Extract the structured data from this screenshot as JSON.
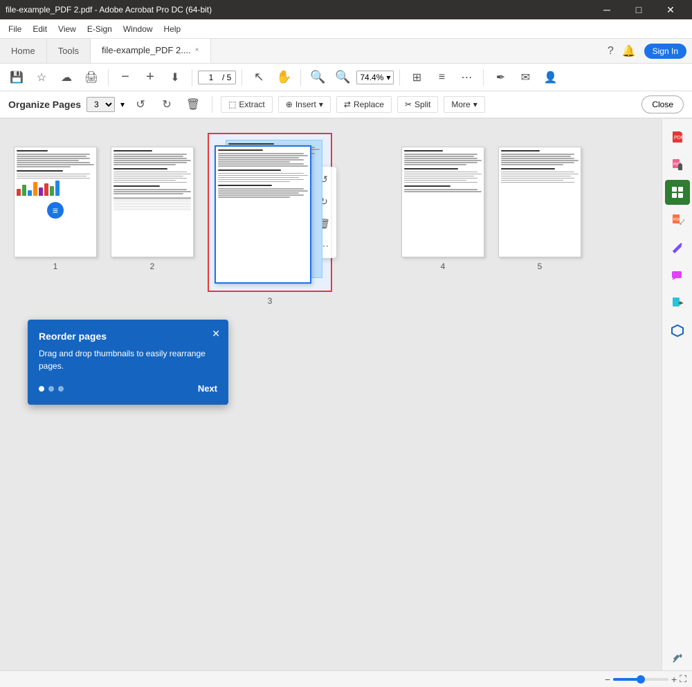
{
  "titlebar": {
    "title": "file-example_PDF 2.pdf - Adobe Acrobat Pro DC (64-bit)",
    "minimize": "─",
    "maximize": "□",
    "close": "✕"
  },
  "menubar": {
    "items": [
      "File",
      "Edit",
      "View",
      "E-Sign",
      "Window",
      "Help"
    ]
  },
  "tabs": {
    "home": "Home",
    "tools": "Tools",
    "file": "file-example_PDF 2....",
    "close_label": "×"
  },
  "tabbar_right": {
    "help": "?",
    "notify": "🔔",
    "signin": "Sign In"
  },
  "toolbar": {
    "save_icon": "💾",
    "bookmark_icon": "☆",
    "upload_icon": "⬆",
    "print_icon": "🖨",
    "zoom_out_icon": "−",
    "zoom_in_icon": "+",
    "page_current": "1",
    "page_total": "5",
    "zoom_value": "74.4%",
    "more_icon": "⋯"
  },
  "organize_toolbar": {
    "label": "Organize Pages",
    "page_num": "3",
    "extract": "Extract",
    "insert": "Insert",
    "replace": "Replace",
    "split": "Split",
    "more": "More",
    "close": "Close"
  },
  "pages": [
    {
      "num": "1",
      "has_chart": true
    },
    {
      "num": "2",
      "has_chart": false
    },
    {
      "num": "3",
      "has_chart": false,
      "selected": true
    },
    {
      "num": "4",
      "has_chart": false
    },
    {
      "num": "5",
      "has_chart": false
    }
  ],
  "reorder_tip": {
    "title": "Reorder pages",
    "body": "Drag and drop thumbnails to easily rearrange pages.",
    "next": "Next",
    "dots": [
      true,
      false,
      false
    ]
  },
  "page_actions": {
    "rotate_ccw": "↺",
    "rotate_cw": "↻",
    "delete": "🗑",
    "more": "⋯"
  },
  "sidebar_icons": [
    {
      "name": "add-pdf-icon",
      "icon": "＋",
      "color": "red"
    },
    {
      "name": "export-icon",
      "icon": "⬆",
      "color": "normal"
    },
    {
      "name": "organize-icon",
      "icon": "▦",
      "color": "green",
      "active": true
    },
    {
      "name": "compress-icon",
      "icon": "⤢",
      "color": "normal"
    },
    {
      "name": "edit-icon",
      "icon": "✏",
      "color": "normal"
    },
    {
      "name": "comment-icon",
      "icon": "◈",
      "color": "normal"
    },
    {
      "name": "share-icon",
      "icon": "⬆",
      "color": "normal"
    },
    {
      "name": "protect-icon",
      "icon": "⬡",
      "color": "normal"
    },
    {
      "name": "tools2-icon",
      "icon": "⚙",
      "color": "normal"
    }
  ]
}
